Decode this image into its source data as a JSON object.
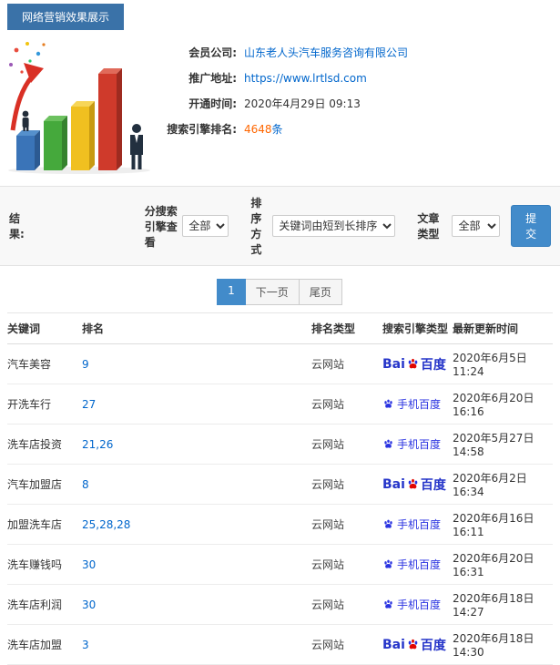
{
  "header": {
    "title": "网络营销效果展示"
  },
  "info": {
    "rows": [
      {
        "label": "会员公司:",
        "value": "山东老人头汽车服务咨询有限公司"
      },
      {
        "label": "推广地址:",
        "value": "https://www.lrtlsd.com"
      },
      {
        "label": "开通时间:",
        "value": "2020年4月29日 09:13"
      },
      {
        "label": "搜索引擎排名:",
        "value": "4648",
        "unit": "条"
      }
    ]
  },
  "filters": {
    "section_label": "结果:",
    "engine_label": "分搜索引擎查看",
    "engine_value": "全部",
    "sort_label": "排序方式",
    "sort_value": "关键词由短到长排序",
    "type_label": "文章类型",
    "type_value": "全部",
    "submit_label": "提交"
  },
  "pagination": {
    "current": "1",
    "next_label": "下一页",
    "last_label": "尾页"
  },
  "table": {
    "headers": [
      "关键词",
      "排名",
      "排名类型",
      "搜索引擎类型",
      "最新更新时间"
    ],
    "engine_logos": {
      "baidu_prefix": "Bai",
      "baidu_suffix": "百度",
      "mobile_label": "手机百度",
      "icon": "baidu-paw-icon"
    },
    "rows": [
      {
        "keyword": "汽车美容",
        "rank": "9",
        "rank_type": "云网站",
        "engine": "baidu",
        "time": "2020年6月5日 11:24"
      },
      {
        "keyword": "开洗车行",
        "rank": "27",
        "rank_type": "云网站",
        "engine": "mobile",
        "time": "2020年6月20日 16:16"
      },
      {
        "keyword": "洗车店投资",
        "rank": "21,26",
        "rank_type": "云网站",
        "engine": "mobile",
        "time": "2020年5月27日 14:58"
      },
      {
        "keyword": "汽车加盟店",
        "rank": "8",
        "rank_type": "云网站",
        "engine": "baidu",
        "time": "2020年6月2日 16:34"
      },
      {
        "keyword": "加盟洗车店",
        "rank": "25,28,28",
        "rank_type": "云网站",
        "engine": "mobile",
        "time": "2020年6月16日 16:11"
      },
      {
        "keyword": "洗车赚钱吗",
        "rank": "30",
        "rank_type": "云网站",
        "engine": "mobile",
        "time": "2020年6月20日 16:31"
      },
      {
        "keyword": "洗车店利润",
        "rank": "30",
        "rank_type": "云网站",
        "engine": "mobile",
        "time": "2020年6月18日 14:27"
      },
      {
        "keyword": "洗车店加盟",
        "rank": "3",
        "rank_type": "云网站",
        "engine": "baidu",
        "time": "2020年6月18日 14:30"
      }
    ]
  },
  "colors": {
    "header_blue": "#3a72a8",
    "accent_blue": "#428bca",
    "link_blue": "#0066cc",
    "highlight_orange": "#ff6600",
    "baidu_blue": "#2932e1",
    "baidu_red": "#e10601"
  }
}
